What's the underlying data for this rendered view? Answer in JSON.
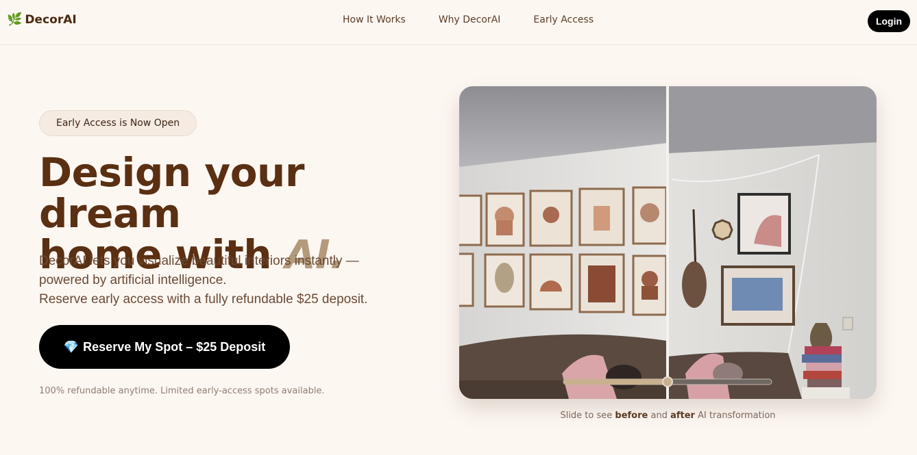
{
  "brand": {
    "name": "DecorAI",
    "logo_icon": "leaf-icon"
  },
  "nav": {
    "links": [
      "How It Works",
      "Why DecorAI",
      "Early Access"
    ],
    "login_label": "Login"
  },
  "hero": {
    "badge": "Early Access is Now Open",
    "headline_line1": "Design your dream",
    "headline_line2": "home with ",
    "headline_accent": "AI.",
    "sub_line1": "DecorAI lets you visualize beautiful interiors instantly —",
    "sub_line2": "powered by artificial intelligence.",
    "sub_line3": "Reserve early access with a fully refundable $25 deposit.",
    "cta_label": "Reserve My Spot – $25 Deposit",
    "cta_icon": "gem-icon",
    "fine_print": "100% refundable anytime. Limited early-access spots available."
  },
  "comparison": {
    "slider_position": 0.5,
    "caption_pre": "Slide to see ",
    "caption_before": "before",
    "caption_mid": " and ",
    "caption_after": "after",
    "caption_post": " AI transformation"
  },
  "colors": {
    "background": "#fdf7f2",
    "headline": "#5a2f12",
    "accent": "#b49a7c",
    "cta": "#000000"
  }
}
